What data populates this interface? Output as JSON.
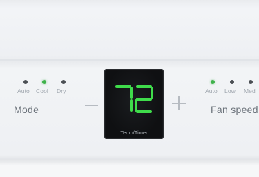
{
  "mode": {
    "label": "Mode",
    "options": [
      {
        "label": "Auto",
        "active": false
      },
      {
        "label": "Cool",
        "active": true
      },
      {
        "label": "Dry",
        "active": false
      }
    ]
  },
  "display": {
    "value": "72",
    "label": "Temp/Timer",
    "digit_color": "#3fdc4b"
  },
  "fan_speed": {
    "label": "Fan speed",
    "options": [
      {
        "label": "Auto",
        "active": true
      },
      {
        "label": "Low",
        "active": false
      },
      {
        "label": "Med",
        "active": false
      }
    ]
  },
  "colors": {
    "indicator_on": "#3fb24b",
    "indicator_off": "#4b4f54"
  }
}
